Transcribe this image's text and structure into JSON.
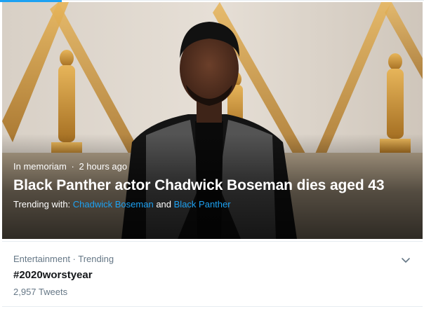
{
  "hero": {
    "category": "In memoriam",
    "separator": "·",
    "time": "2 hours ago",
    "headline": "Black Panther actor Chadwick Boseman dies aged 43",
    "trending_with_label": "Trending with:",
    "trending_link_1": "Chadwick Boseman",
    "trending_and": "and",
    "trending_link_2": "Black Panther",
    "image_icon": "photo-of-actor-at-event"
  },
  "trend": {
    "meta": "Entertainment · Trending",
    "title": "#2020worstyear",
    "count": "2,957 Tweets",
    "menu_icon": "chevron-down-icon"
  },
  "colors": {
    "accent": "#1da1f2",
    "text_primary": "#14171a",
    "text_secondary": "#657786",
    "divider": "#e6ecf0"
  }
}
